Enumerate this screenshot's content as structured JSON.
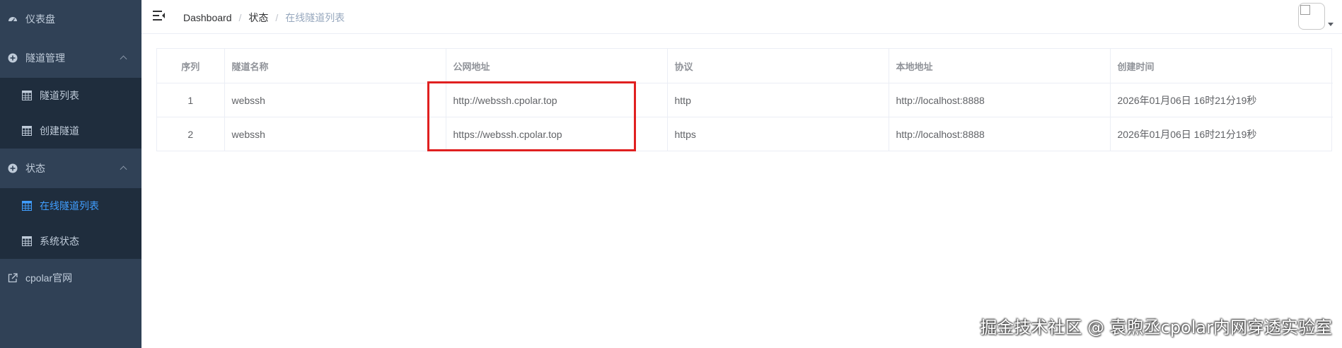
{
  "sidebar": {
    "items": [
      {
        "label": "仪表盘",
        "icon": "dashboard-icon"
      },
      {
        "label": "隧道管理",
        "icon": "plus-circle-icon",
        "expanded": true,
        "children": [
          {
            "label": "隧道列表",
            "icon": "table-icon"
          },
          {
            "label": "创建隧道",
            "icon": "table-icon"
          }
        ]
      },
      {
        "label": "状态",
        "icon": "plus-circle-icon",
        "expanded": true,
        "children": [
          {
            "label": "在线隧道列表",
            "icon": "table-icon",
            "active": true
          },
          {
            "label": "系统状态",
            "icon": "table-icon"
          }
        ]
      },
      {
        "label": "cpolar官网",
        "icon": "external-link-icon"
      }
    ]
  },
  "header": {
    "breadcrumb": [
      "Dashboard",
      "状态",
      "在线隧道列表"
    ]
  },
  "table": {
    "columns": [
      "序列",
      "隧道名称",
      "公网地址",
      "协议",
      "本地地址",
      "创建时间"
    ],
    "rows": [
      [
        "1",
        "webssh",
        "http://webssh.cpolar.top",
        "http",
        "http://localhost:8888",
        "2026年01月06日 16时21分19秒"
      ],
      [
        "2",
        "webssh",
        "https://webssh.cpolar.top",
        "https",
        "http://localhost:8888",
        "2026年01月06日 16时21分19秒"
      ]
    ]
  },
  "watermark": "掘金技术社区 @ 袁煦丞cpolar内网穿透实验室",
  "colors": {
    "sidebar_bg": "#304156",
    "submenu_bg": "#1f2d3d",
    "active": "#409eff",
    "highlight": "#e02020"
  }
}
